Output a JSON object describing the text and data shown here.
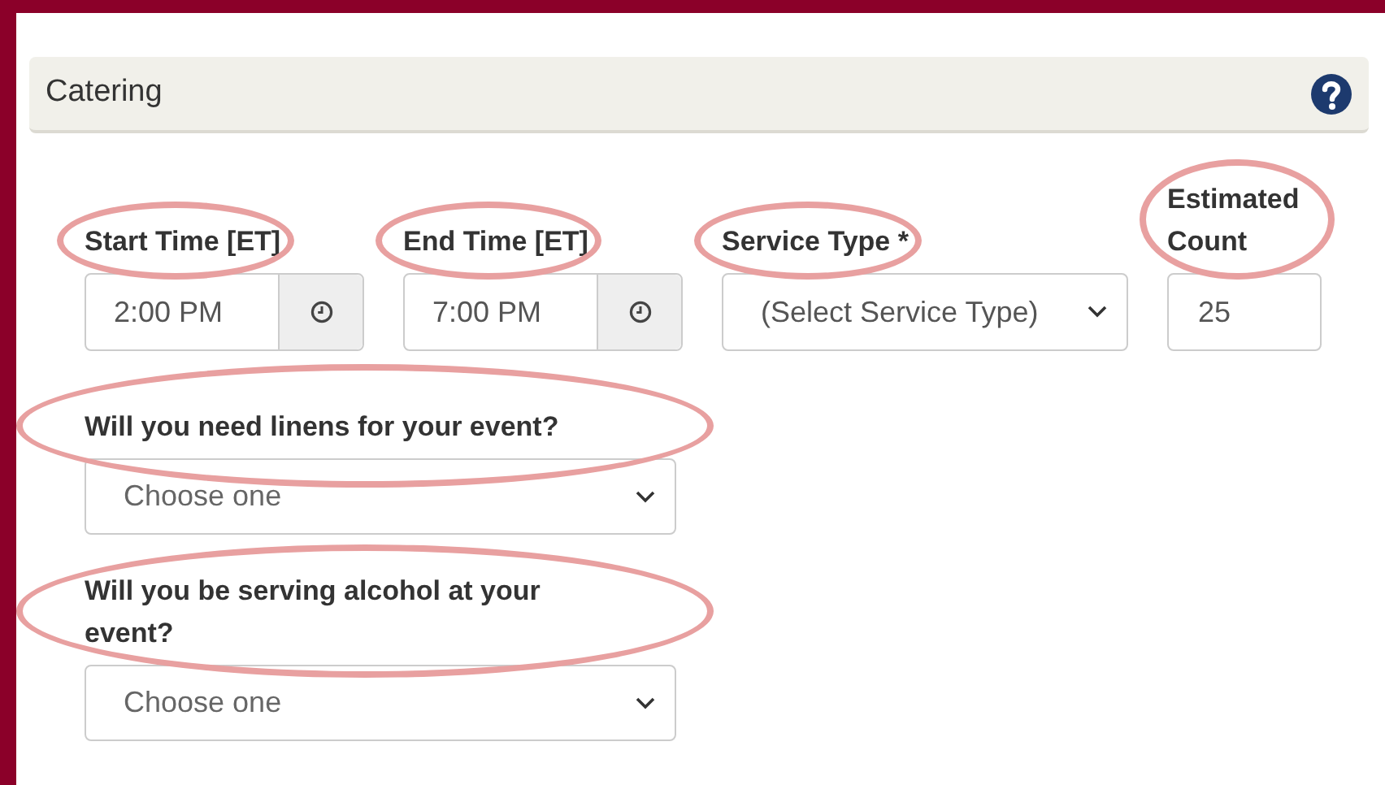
{
  "panel": {
    "title": "Catering"
  },
  "fields": [
    {
      "kind": "time",
      "label": "Start Time [ET]",
      "value": "2:00 PM",
      "circled": true
    },
    {
      "kind": "time",
      "label": "End Time [ET]",
      "value": "7:00 PM",
      "circled": true
    },
    {
      "kind": "select",
      "label": "Service Type *",
      "value": "(Select Service Type)",
      "circled": true
    },
    {
      "kind": "number",
      "label": "Estimated Count",
      "value": "25",
      "circled": true
    }
  ],
  "questions": [
    {
      "label": "Will you need linens for your event?",
      "value": "Choose one",
      "circled": true
    },
    {
      "label": "Will you be serving alcohol at your event?",
      "value": "Choose one",
      "circled": true
    }
  ]
}
